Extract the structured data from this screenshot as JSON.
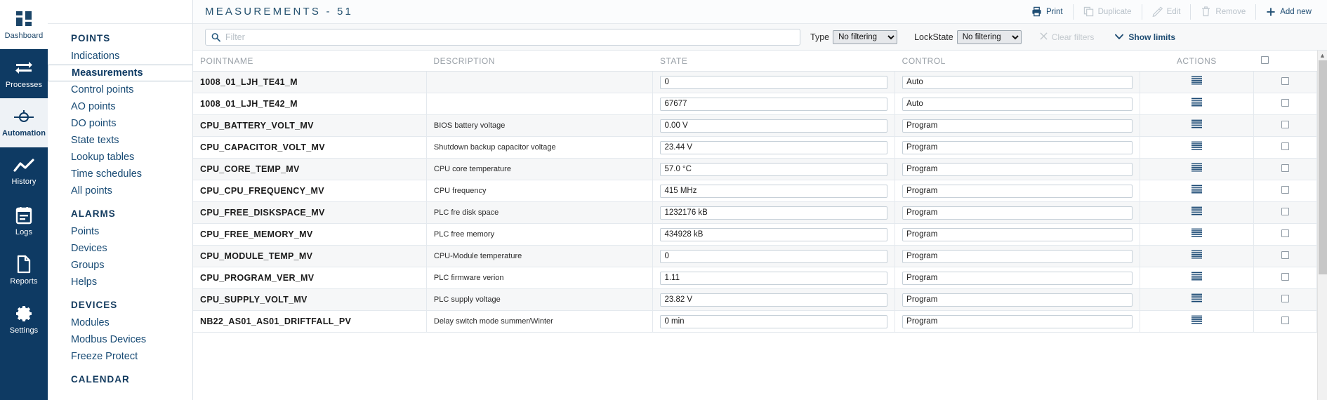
{
  "rail": {
    "items": [
      {
        "label": "Dashboard",
        "icon": "dashboard-icon",
        "state": "light"
      },
      {
        "label": "Processes",
        "icon": "processes-icon",
        "state": "normal"
      },
      {
        "label": "Automation",
        "icon": "automation-icon",
        "state": "active"
      },
      {
        "label": "History",
        "icon": "history-chart-icon",
        "state": "normal"
      },
      {
        "label": "Logs",
        "icon": "logs-icon",
        "state": "normal"
      },
      {
        "label": "Reports",
        "icon": "reports-document-icon",
        "state": "normal"
      },
      {
        "label": "Settings",
        "icon": "gear-icon",
        "state": "normal"
      }
    ]
  },
  "nav": {
    "groups": [
      {
        "title": "POINTS",
        "items": [
          {
            "label": "Indications",
            "selected": false
          },
          {
            "label": "Measurements",
            "selected": true
          },
          {
            "label": "Control points",
            "selected": false
          },
          {
            "label": "AO points",
            "selected": false
          },
          {
            "label": "DO points",
            "selected": false
          },
          {
            "label": "State texts",
            "selected": false
          },
          {
            "label": "Lookup tables",
            "selected": false
          },
          {
            "label": "Time schedules",
            "selected": false
          },
          {
            "label": "All points",
            "selected": false
          }
        ]
      },
      {
        "title": "ALARMS",
        "items": [
          {
            "label": "Points",
            "selected": false
          },
          {
            "label": "Devices",
            "selected": false
          },
          {
            "label": "Groups",
            "selected": false
          },
          {
            "label": "Helps",
            "selected": false
          }
        ]
      },
      {
        "title": "DEVICES",
        "items": [
          {
            "label": "Modules",
            "selected": false
          },
          {
            "label": "Modbus Devices",
            "selected": false
          },
          {
            "label": "Freeze Protect",
            "selected": false
          }
        ]
      },
      {
        "title": "CALENDAR",
        "items": []
      }
    ]
  },
  "header": {
    "title": "MEASUREMENTS - 51",
    "actions": [
      {
        "label": "Print",
        "icon": "printer-icon",
        "disabled": false
      },
      {
        "label": "Duplicate",
        "icon": "copy-icon",
        "disabled": true
      },
      {
        "label": "Edit",
        "icon": "pencil-icon",
        "disabled": true
      },
      {
        "label": "Remove",
        "icon": "trash-icon",
        "disabled": true
      },
      {
        "label": "Add new",
        "icon": "plus-icon",
        "disabled": false
      }
    ]
  },
  "filters": {
    "search_placeholder": "Filter",
    "search_value": "",
    "type_label": "Type",
    "type_value": "No filtering",
    "type_options": [
      "No filtering"
    ],
    "lockstate_label": "LockState",
    "lockstate_value": "No filtering",
    "lockstate_options": [
      "No filtering"
    ],
    "clear_filters_label": "Clear filters",
    "show_limits_label": "Show limits"
  },
  "table": {
    "columns": [
      "POINTNAME",
      "DESCRIPTION",
      "STATE",
      "CONTROL",
      "ACTIONS",
      ""
    ],
    "header_checkbox_checked": false,
    "rows": [
      {
        "pointname": "1008_01_LJH_TE41_M",
        "description": "",
        "state": "0",
        "control": "Auto",
        "action_icon": "list-lines-icon",
        "checked": false
      },
      {
        "pointname": "1008_01_LJH_TE42_M",
        "description": "",
        "state": "67677",
        "control": "Auto",
        "action_icon": "list-lines-icon",
        "checked": false
      },
      {
        "pointname": "CPU_BATTERY_VOLT_MV",
        "description": "BIOS battery voltage",
        "state": "0.00 V",
        "control": "Program",
        "action_icon": "list-lines-icon",
        "checked": false
      },
      {
        "pointname": "CPU_CAPACITOR_VOLT_MV",
        "description": "Shutdown backup capacitor voltage",
        "state": "23.44 V",
        "control": "Program",
        "action_icon": "list-lines-icon",
        "checked": false
      },
      {
        "pointname": "CPU_CORE_TEMP_MV",
        "description": "CPU core temperature",
        "state": "57.0 °C",
        "control": "Program",
        "action_icon": "list-lines-icon",
        "checked": false
      },
      {
        "pointname": "CPU_CPU_FREQUENCY_MV",
        "description": "CPU frequency",
        "state": "415 MHz",
        "control": "Program",
        "action_icon": "list-lines-icon",
        "checked": false
      },
      {
        "pointname": "CPU_FREE_DISKSPACE_MV",
        "description": "PLC fre disk space",
        "state": "1232176 kB",
        "control": "Program",
        "action_icon": "list-lines-icon",
        "checked": false
      },
      {
        "pointname": "CPU_FREE_MEMORY_MV",
        "description": "PLC free memory",
        "state": "434928 kB",
        "control": "Program",
        "action_icon": "list-lines-icon",
        "checked": false
      },
      {
        "pointname": "CPU_MODULE_TEMP_MV",
        "description": "CPU-Module temperature",
        "state": "0",
        "control": "Program",
        "action_icon": "list-lines-icon",
        "checked": false
      },
      {
        "pointname": "CPU_PROGRAM_VER_MV",
        "description": "PLC firmware verion",
        "state": "1.11",
        "control": "Program",
        "action_icon": "list-lines-icon",
        "checked": false
      },
      {
        "pointname": "CPU_SUPPLY_VOLT_MV",
        "description": "PLC supply voltage",
        "state": "23.82 V",
        "control": "Program",
        "action_icon": "list-lines-icon",
        "checked": false
      },
      {
        "pointname": "NB22_AS01_AS01_DRIFTFALL_PV",
        "description": "Delay switch mode summer/Winter",
        "state": "0 min",
        "control": "Program",
        "action_icon": "list-lines-icon",
        "checked": false
      }
    ]
  },
  "colors": {
    "rail_bg": "#0e3a63",
    "accent": "#1f4d73",
    "row_alt": "#f6f7f8",
    "border": "#e4e9ee"
  }
}
